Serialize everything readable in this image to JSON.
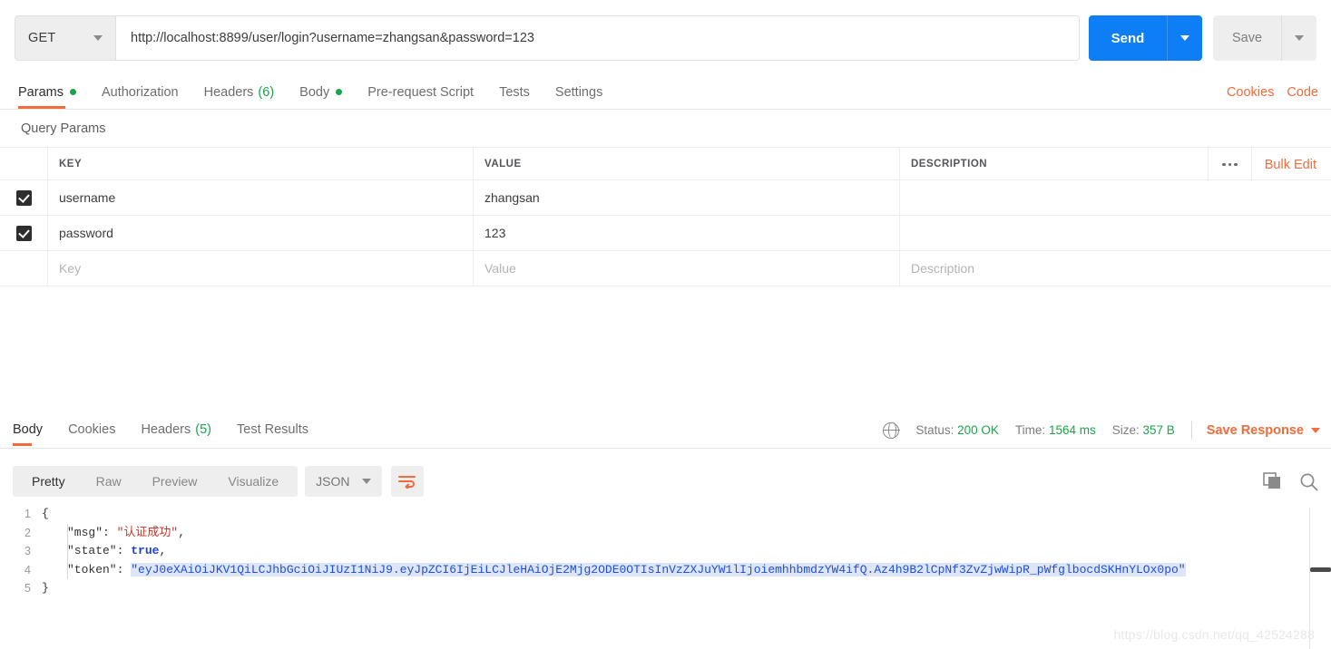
{
  "request": {
    "method": "GET",
    "url": "http://localhost:8899/user/login?username=zhangsan&password=123",
    "send_label": "Send",
    "save_label": "Save"
  },
  "request_tabs": [
    {
      "label": "Params",
      "badge_dot": true,
      "active": true
    },
    {
      "label": "Authorization",
      "active": false
    },
    {
      "label": "Headers",
      "count": "(6)",
      "active": false
    },
    {
      "label": "Body",
      "badge_dot": true,
      "active": false
    },
    {
      "label": "Pre-request Script",
      "active": false
    },
    {
      "label": "Tests",
      "active": false
    },
    {
      "label": "Settings",
      "active": false
    }
  ],
  "request_tabs_right": {
    "cookies": "Cookies",
    "code": "Code"
  },
  "query_params": {
    "title": "Query Params",
    "columns": [
      "KEY",
      "VALUE",
      "DESCRIPTION"
    ],
    "bulk_edit_label": "Bulk Edit",
    "rows": [
      {
        "checked": true,
        "key": "username",
        "value": "zhangsan",
        "description": ""
      },
      {
        "checked": true,
        "key": "password",
        "value": "123",
        "description": ""
      }
    ],
    "placeholder_row": {
      "key": "Key",
      "value": "Value",
      "description": "Description"
    }
  },
  "response_tabs": [
    {
      "label": "Body",
      "active": true
    },
    {
      "label": "Cookies",
      "active": false
    },
    {
      "label": "Headers",
      "count": "(5)",
      "active": false
    },
    {
      "label": "Test Results",
      "active": false
    }
  ],
  "response_status": {
    "status_label": "Status:",
    "status_value": "200 OK",
    "time_label": "Time:",
    "time_value": "1564 ms",
    "size_label": "Size:",
    "size_value": "357 B",
    "save_response_label": "Save Response"
  },
  "body_toolbar": {
    "views": [
      {
        "label": "Pretty",
        "active": true
      },
      {
        "label": "Raw",
        "active": false
      },
      {
        "label": "Preview",
        "active": false
      },
      {
        "label": "Visualize",
        "active": false
      }
    ],
    "format": "JSON"
  },
  "body_code": {
    "lines": [
      {
        "no": "1",
        "indent": 0,
        "parts": [
          {
            "t": "{",
            "c": "brace"
          }
        ]
      },
      {
        "no": "2",
        "indent": 1,
        "parts": [
          {
            "t": "\"msg\"",
            "c": "k-str"
          },
          {
            "t": ": ",
            "c": "punc"
          },
          {
            "t": "\"认证成功\"",
            "c": "v-str"
          },
          {
            "t": ",",
            "c": "punc"
          }
        ]
      },
      {
        "no": "3",
        "indent": 1,
        "parts": [
          {
            "t": "\"state\"",
            "c": "k-str"
          },
          {
            "t": ": ",
            "c": "punc"
          },
          {
            "t": "true",
            "c": "v-bool"
          },
          {
            "t": ",",
            "c": "punc"
          }
        ]
      },
      {
        "no": "4",
        "indent": 1,
        "parts": [
          {
            "t": "\"token\"",
            "c": "k-str"
          },
          {
            "t": ": ",
            "c": "punc"
          },
          {
            "t": "\"eyJ0eXAiOiJKV1QiLCJhbGciOiJIUzI1NiJ9.eyJpZCI6IjEiLCJleHAiOjE2Mjg2ODE0OTIsInVzZXJuYW1lIjoiemhhbmdzYW4ifQ.Az4h9B2lCpNf3ZvZjwWipR_pWfglbocdSKHnYLOx0po\"",
            "c": "token-hl"
          }
        ]
      },
      {
        "no": "5",
        "indent": 0,
        "parts": [
          {
            "t": "}",
            "c": "brace"
          }
        ]
      }
    ]
  },
  "watermark": "https://blog.csdn.net/qq_42524288",
  "colors": {
    "accent_orange": "#f26b3a",
    "send_blue": "#0d7ef5",
    "status_green": "#1aa54b",
    "token_highlight": "#dde5f7"
  }
}
